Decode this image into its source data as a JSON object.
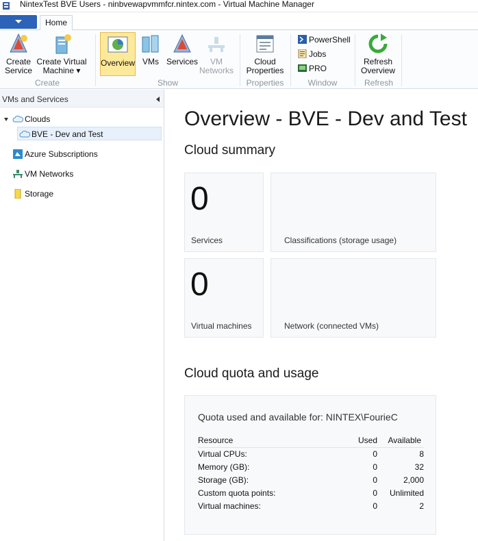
{
  "window": {
    "title": "NintexTest BVE Users - ninbvewapvmmfcr.nintex.com - Virtual Machine Manager"
  },
  "ribbon": {
    "tab_home": "Home",
    "create_service": "Create\nService",
    "create_vm_line1": "Create Virtual",
    "create_vm_line2": "Machine ▾",
    "overview": "Overview",
    "vms": "VMs",
    "services": "Services",
    "vm_networks_line1": "VM",
    "vm_networks_line2": "Networks",
    "cloud_props_line1": "Cloud",
    "cloud_props_line2": "Properties",
    "powershell": "PowerShell",
    "jobs": "Jobs",
    "pro": "PRO",
    "refresh_line1": "Refresh",
    "refresh_line2": "Overview",
    "groups": {
      "create": "Create",
      "show": "Show",
      "properties": "Properties",
      "window": "Window",
      "refresh": "Refresh"
    }
  },
  "nav": {
    "header": "VMs and Services",
    "clouds": "Clouds",
    "bve_dev_test": "BVE - Dev and Test",
    "azure": "Azure Subscriptions",
    "vm_networks": "VM Networks",
    "storage": "Storage"
  },
  "main": {
    "title": "Overview - BVE - Dev and Test",
    "summary_title": "Cloud summary",
    "services_count": "0",
    "services_label": "Services",
    "classifications_label": "Classifications (storage usage)",
    "vms_count": "0",
    "vms_label": "Virtual machines",
    "network_label": "Network (connected VMs)",
    "quota_title": "Cloud quota and usage",
    "quota_header": "Quota used and available for: NINTEX\\FourieC",
    "columns": [
      "Resource",
      "Used",
      "Available"
    ],
    "rows": [
      [
        "Virtual CPUs:",
        "0",
        "8"
      ],
      [
        "Memory (GB):",
        "0",
        "32"
      ],
      [
        "Storage (GB):",
        "0",
        "2,000"
      ],
      [
        "Custom quota points:",
        "0",
        "Unlimited"
      ],
      [
        "Virtual machines:",
        "0",
        "2"
      ]
    ]
  },
  "colors": {
    "file_button": "#2c62b8",
    "active_button": "#fde99a",
    "tile_background": "#f7f9fb"
  }
}
